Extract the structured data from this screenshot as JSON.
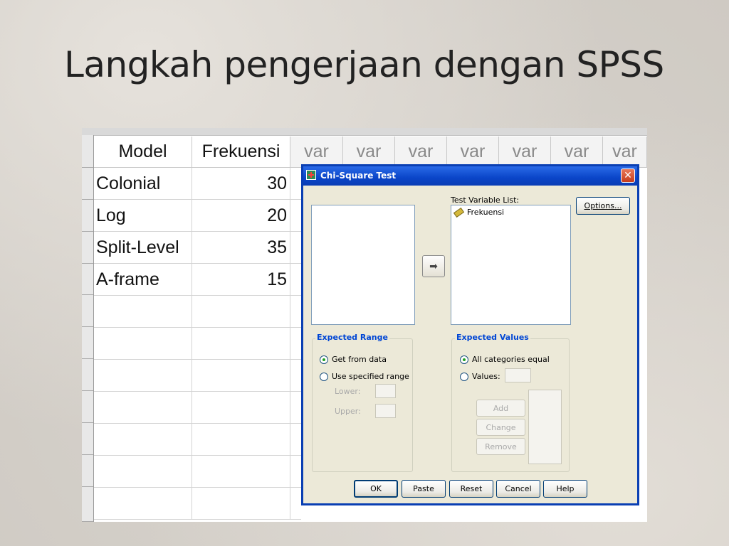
{
  "slide": {
    "title": "Langkah pengerjaan dengan SPSS"
  },
  "sheet": {
    "columns": [
      "Model",
      "Frekuensi",
      "var",
      "var",
      "var",
      "var",
      "var",
      "var",
      "var"
    ],
    "rows": [
      {
        "model": "Colonial",
        "frekuensi": "30"
      },
      {
        "model": "Log",
        "frekuensi": "20"
      },
      {
        "model": "Split-Level",
        "frekuensi": "35"
      },
      {
        "model": "A-frame",
        "frekuensi": "15"
      }
    ]
  },
  "dialog": {
    "title": "Chi-Square Test",
    "close_glyph": "✕",
    "test_variable_label": "Test Variable List:",
    "test_variables": [
      "Frekuensi"
    ],
    "options_button": "Options...",
    "move_arrow_glyph": "➡",
    "expected_range": {
      "title": "Expected Range",
      "get_from_data": "Get from data",
      "use_specified_range": "Use specified range",
      "lower": "Lower:",
      "upper": "Upper:",
      "selected": "get_from_data"
    },
    "expected_values": {
      "title": "Expected Values",
      "all_categories_equal": "All categories equal",
      "values": "Values:",
      "add": "Add",
      "change": "Change",
      "remove": "Remove",
      "selected": "all_categories_equal"
    },
    "buttons": {
      "ok": "OK",
      "paste": "Paste",
      "reset": "Reset",
      "cancel": "Cancel",
      "help": "Help"
    }
  },
  "colors": {
    "titlebar": "#0a45c8",
    "dialog_bg": "#ece9d8",
    "group_title": "#0046d5"
  }
}
